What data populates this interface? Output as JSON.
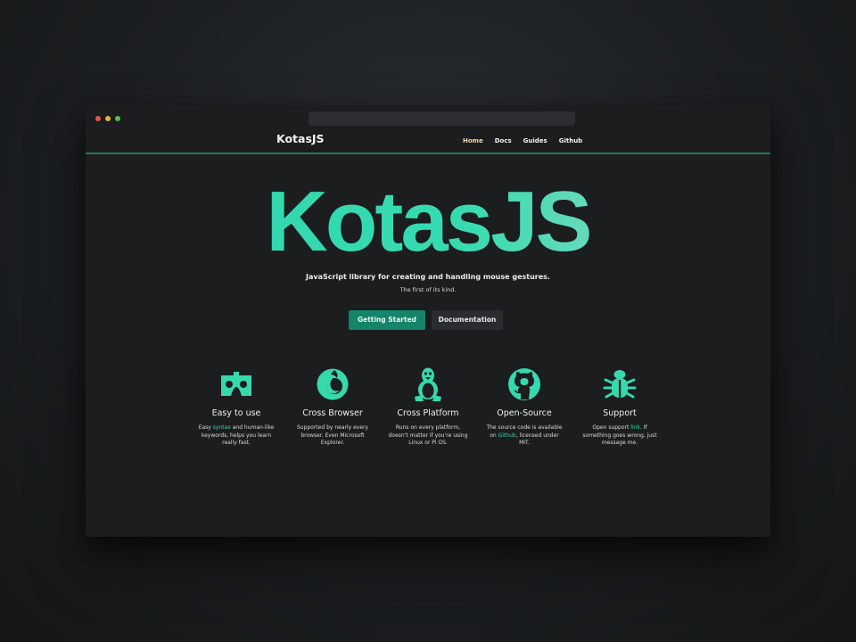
{
  "brand": "KotasJS",
  "nav": [
    "Home",
    "Docs",
    "Guides",
    "Github"
  ],
  "hero": {
    "title": "KotasJS",
    "tagline": "JavaScript library for creating and handling mouse gestures.",
    "subtagline": "The first of its kind."
  },
  "buttons": {
    "primary": "Getting Started",
    "secondary": "Documentation"
  },
  "features": [
    {
      "icon": "vr-cardboard-icon",
      "title": "Easy to use",
      "desc_pre": "Easy ",
      "desc_link": "syntax",
      "desc_post": " and human-like keywords, helps you learn really fast."
    },
    {
      "icon": "firefox-browser-icon",
      "title": "Cross Browser",
      "desc_pre": "Supported by nearly every browser. Even Microsoft Explorer.",
      "desc_link": "",
      "desc_post": ""
    },
    {
      "icon": "linux-tux-icon",
      "title": "Cross Platform",
      "desc_pre": "Runs on every platform, doesn't matter if you're using Linux or Pi OS.",
      "desc_link": "",
      "desc_post": ""
    },
    {
      "icon": "github-icon",
      "title": "Open-Source",
      "desc_pre": "The source code is available on ",
      "desc_link": "Github",
      "desc_post": ", licensed under MIT."
    },
    {
      "icon": "bug-icon",
      "title": "Support",
      "desc_pre": "Open support ",
      "desc_link": "link",
      "desc_post": ". If something goes wrong, just message me."
    }
  ],
  "colors": {
    "accent": "#36d8ae",
    "primary_button": "#16846a",
    "nav_active": "#f0d9b4",
    "nav_border": "#1f7a5c"
  }
}
